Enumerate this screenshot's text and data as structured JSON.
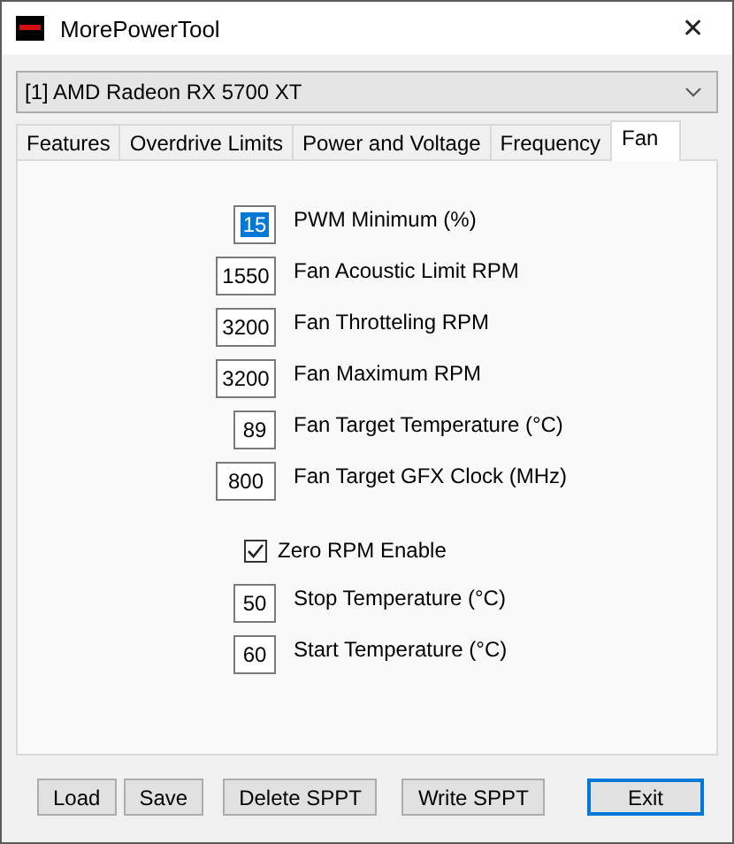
{
  "window": {
    "title": "MorePowerTool",
    "close": "✕"
  },
  "device_select": {
    "value": "[1] AMD Radeon RX 5700 XT"
  },
  "tabs": [
    {
      "label": "Features",
      "selected": false
    },
    {
      "label": "Overdrive Limits",
      "selected": false
    },
    {
      "label": "Power and Voltage",
      "selected": false
    },
    {
      "label": "Frequency",
      "selected": false
    },
    {
      "label": "Fan",
      "selected": true
    }
  ],
  "fan_settings": [
    {
      "value": "15",
      "label": "PWM Minimum (%)",
      "kind": "short",
      "selected": true
    },
    {
      "value": "1550",
      "label": "Fan Acoustic Limit RPM",
      "kind": "long",
      "selected": false
    },
    {
      "value": "3200",
      "label": "Fan Throtteling RPM",
      "kind": "long",
      "selected": false
    },
    {
      "value": "3200",
      "label": "Fan Maximum RPM",
      "kind": "long",
      "selected": false
    },
    {
      "value": "89",
      "label": "Fan Target Temperature (°C)",
      "kind": "short",
      "selected": false
    },
    {
      "value": "800",
      "label": "Fan Target GFX Clock (MHz)",
      "kind": "long",
      "selected": false
    }
  ],
  "zero_rpm": {
    "label": "Zero RPM Enable",
    "checked": true
  },
  "zero_rpm_settings": [
    {
      "value": "50",
      "label": "Stop Temperature (°C)",
      "kind": "short",
      "selected": false
    },
    {
      "value": "60",
      "label": "Start Temperature (°C)",
      "kind": "short",
      "selected": false
    }
  ],
  "buttons": [
    {
      "label": "Load",
      "focused": false
    },
    {
      "label": "Save",
      "focused": false
    },
    {
      "label": "Delete SPPT",
      "focused": false
    },
    {
      "label": "Write SPPT",
      "focused": false
    }
  ],
  "exit_button": {
    "label": "Exit",
    "focused": true
  }
}
